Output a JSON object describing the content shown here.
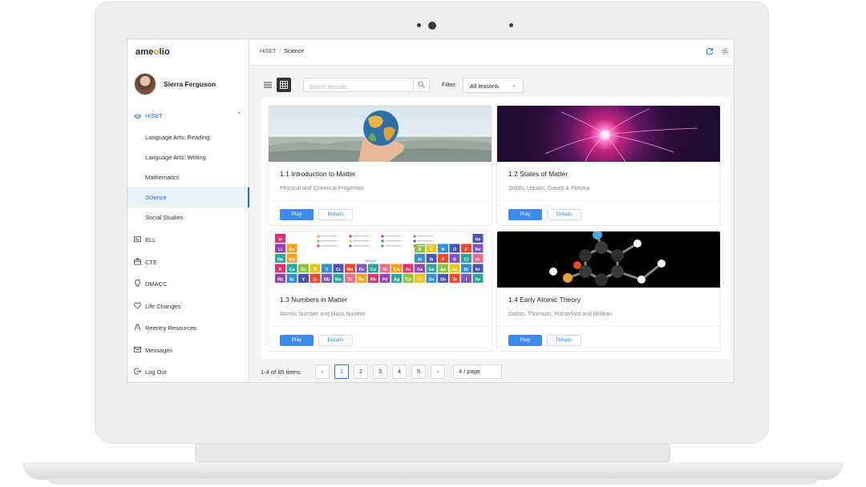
{
  "app": {
    "logo_prefix": "ame",
    "logo_o": "o",
    "logo_suffix": "lio"
  },
  "user": {
    "name": "Sierra Ferguson"
  },
  "sidebar": {
    "section": {
      "label": "HiSET",
      "icon": "graduation-icon"
    },
    "sub_items": [
      {
        "label": "Language Arts: Reading"
      },
      {
        "label": "Language Arts: Writing"
      },
      {
        "label": "Mathematics"
      },
      {
        "label": "Science",
        "active": true
      },
      {
        "label": "Social Studies"
      }
    ],
    "items": [
      {
        "label": "ELL",
        "icon": "id-card-icon"
      },
      {
        "label": "CTE",
        "icon": "briefcase-icon"
      },
      {
        "label": "DMACC",
        "icon": "lightbulb-icon"
      },
      {
        "label": "Life Changes",
        "icon": "heart-icon"
      },
      {
        "label": "Reentry Resources",
        "icon": "path-icon"
      },
      {
        "label": "Messages",
        "icon": "mail-icon"
      },
      {
        "label": "Log Out",
        "icon": "logout-icon"
      }
    ]
  },
  "breadcrumb": {
    "root": "HiSET",
    "separator": "/",
    "current": "Science"
  },
  "toolbar": {
    "search_placeholder": "Search lessons",
    "filter_label": "Filter:",
    "filter_value": "All lessons"
  },
  "lessons": [
    {
      "title": "1.1 Introduction to Matter",
      "subtitle": "Physical and Chemical Properties",
      "play": "Play",
      "details": "Details",
      "image": "globe-in-hand"
    },
    {
      "title": "1.2 States of Matter",
      "subtitle": "Solids, Liquids, Gases & Plasma",
      "play": "Play",
      "details": "Details",
      "image": "plasma-ball"
    },
    {
      "title": "1.3 Numbers in Matter",
      "subtitle": "Atomic Number and Mass Number",
      "play": "Play",
      "details": "Details",
      "image": "periodic-table"
    },
    {
      "title": "1.4 Early Atomic Theory",
      "subtitle": "Dalton, Thomson, Rutherford and Millikan",
      "play": "Play",
      "details": "Details",
      "image": "molecule-model"
    }
  ],
  "periodic": {
    "top_left": [
      "H",
      "Li",
      "Na",
      "K",
      "Rb"
    ],
    "top_right": [
      "He",
      "Ne",
      "Ar",
      "Kr",
      "Xe"
    ],
    "group_label": "GROUP",
    "row4": [
      "K",
      "Ca",
      "Sc",
      "Ti",
      "V",
      "Cr",
      "Mn",
      "Fe",
      "Co",
      "Ni",
      "Cu",
      "Zn",
      "Ga",
      "Ge",
      "As",
      "Se",
      "Br",
      "Kr"
    ],
    "row5": [
      "Rb",
      "Sr",
      "Y",
      "Zr",
      "Nb",
      "Mo",
      "Tc",
      "Ru",
      "Rh",
      "Pd",
      "Ag",
      "Cd",
      "In",
      "Sn",
      "Sb",
      "Te",
      "I",
      "Xe"
    ],
    "row3_right": [
      "Al",
      "Si",
      "P",
      "S",
      "Cl",
      "Ar"
    ],
    "row2_right": [
      "B",
      "C",
      "N",
      "O",
      "F",
      "Ne"
    ]
  },
  "pagination": {
    "total": "1-4 of 85 items",
    "pages": [
      "1",
      "2",
      "3",
      "4",
      "5"
    ],
    "current": "1",
    "prev": "‹",
    "next": "›",
    "page_size": "4 / page"
  },
  "colors": {
    "accent": "#1a73e8",
    "play": "#3d8bf2",
    "logo_o": "#f08a24"
  }
}
